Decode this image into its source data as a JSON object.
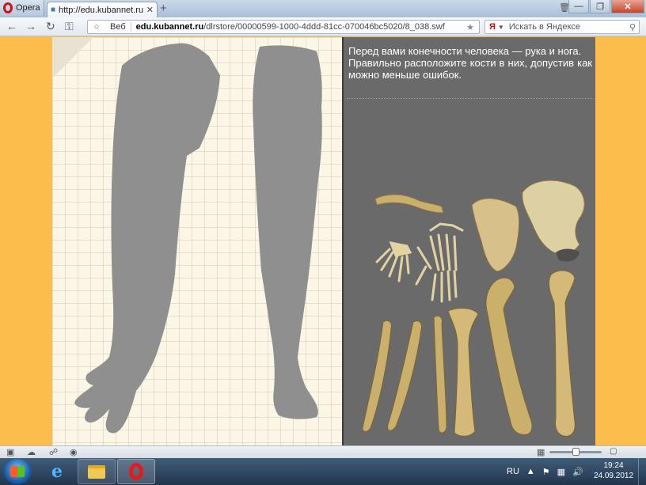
{
  "browser": {
    "menu_label": "Opera",
    "tab_title": "http://edu.kubannet.ru...",
    "new_tab_symbol": "+",
    "address_mode": "Веб",
    "url_host": "edu.kubannet.ru",
    "url_path": "/dlrstore/00000599-1000-4ddd-81cc-070046bc5020/8_038.swf",
    "search_engine": "Я",
    "search_placeholder": "Искать в Яндексе"
  },
  "activity": {
    "instructions_line1": "Перед вами конечности человека — рука и нога.",
    "instructions_line2": "Правильно расположите кости в них, допустив как можно меньше ошибок.",
    "silhouettes": [
      "arm",
      "leg"
    ],
    "bones": [
      "clavicle",
      "scapula",
      "hip-bone",
      "hand-skeleton",
      "foot-skeleton",
      "ulna",
      "radius",
      "fibula",
      "tibia",
      "femur",
      "humerus"
    ]
  },
  "statusbar": {
    "zoom_level": 0.5
  },
  "taskbar": {
    "language": "RU",
    "time": "19:24",
    "date": "24.09.2012"
  },
  "colors": {
    "page_background": "#fbbe4a",
    "silhouette": "#8f8f8f",
    "bone": "#cbb06c",
    "right_panel": "#6a6a6a"
  }
}
